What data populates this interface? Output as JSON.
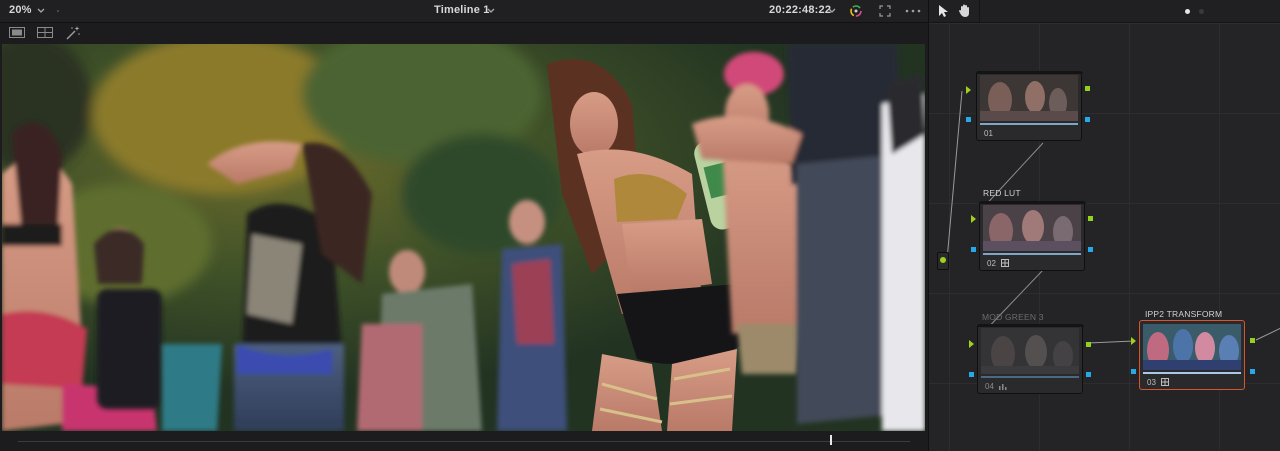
{
  "viewer": {
    "zoom": "20%",
    "timeline_title": "Timeline 1",
    "timecode": "20:22:48:22",
    "playhead_fraction": 0.91
  },
  "toolbar": {
    "zoom_icon": "chevron-down-icon",
    "timeline_icon": "chevron-down-icon",
    "timecode_icon": "chevron-down-icon",
    "color_wheel_icon": "color-wheel-icon",
    "fullscreen_icon": "expand-icon",
    "more_icon": "more-icon",
    "single_view_icon": "single-view-icon",
    "split_view_icon": "split-view-icon",
    "magic_wand_icon": "magic-wand-icon"
  },
  "node_editor": {
    "pointer_tool": "pointer-icon",
    "hand_tool": "hand-icon",
    "nodes": [
      {
        "label": "",
        "number": "01",
        "selected": false
      },
      {
        "label": "RED LUT",
        "number": "02",
        "selected": false
      },
      {
        "label": "MOD GREEN 3",
        "number": "04",
        "selected": false
      },
      {
        "label": "IPP2 TRANSFORM",
        "number": "03",
        "selected": true
      }
    ]
  },
  "colors": {
    "accent_selected": "#d7542f",
    "port_green": "#92d21a",
    "port_blue": "#27a9e8",
    "background": "#1e1e20"
  }
}
